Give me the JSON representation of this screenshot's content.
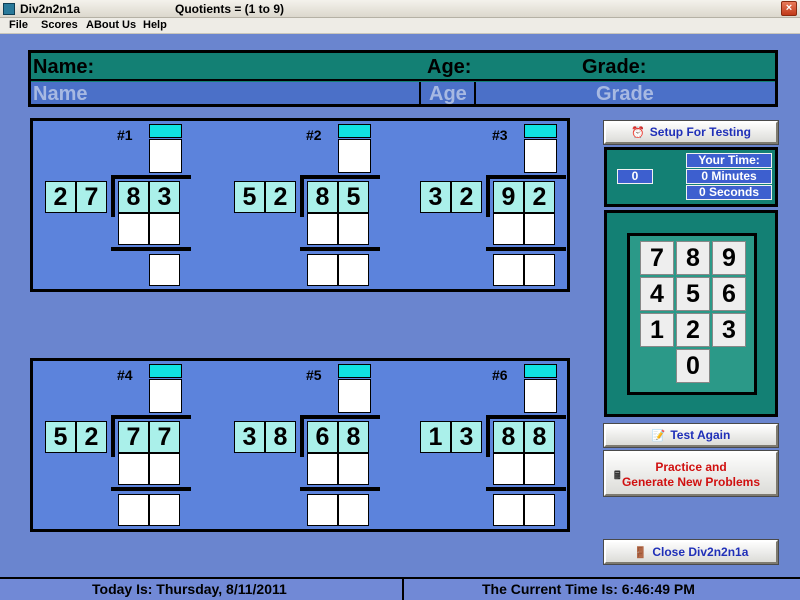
{
  "window": {
    "app_name": "Div2n2n1a",
    "title": "Quotients = (1 to 9)",
    "close_glyph": "×"
  },
  "menu": [
    {
      "label": "File"
    },
    {
      "label": "Scores"
    },
    {
      "label": "ABout Us"
    },
    {
      "label": "Help"
    }
  ],
  "student_info": {
    "name_label": "Name:",
    "age_label": "Age:",
    "grade_label": "Grade:",
    "name_placeholder": "Name",
    "age_placeholder": "Age",
    "grade_placeholder": "Grade"
  },
  "problems": [
    {
      "label": "#1",
      "divisor": [
        "2",
        "7"
      ],
      "dividend": [
        "8",
        "3"
      ]
    },
    {
      "label": "#2",
      "divisor": [
        "5",
        "2"
      ],
      "dividend": [
        "8",
        "5"
      ]
    },
    {
      "label": "#3",
      "divisor": [
        "3",
        "2"
      ],
      "dividend": [
        "9",
        "2"
      ]
    },
    {
      "label": "#4",
      "divisor": [
        "5",
        "2"
      ],
      "dividend": [
        "7",
        "7"
      ]
    },
    {
      "label": "#5",
      "divisor": [
        "3",
        "8"
      ],
      "dividend": [
        "6",
        "8"
      ]
    },
    {
      "label": "#6",
      "divisor": [
        "1",
        "3"
      ],
      "dividend": [
        "8",
        "8"
      ]
    }
  ],
  "controls": {
    "setup_label": "Setup  For Testing",
    "setup_icon": "alarm-clock-icon",
    "test_again_label": "Test Again",
    "test_again_icon": "notepad-icon",
    "practice_label_1": "Practice and",
    "practice_label_2": "Generate New Problems",
    "practice_icon": "calculator-icon",
    "close_label": "Close Div2n2n1a",
    "close_icon": "door-exit-icon"
  },
  "timer": {
    "count": "0",
    "your_time_label": "Your Time:",
    "minutes": "0 Minutes",
    "seconds": "0 Seconds"
  },
  "keypad": {
    "rows": [
      [
        "7",
        "8",
        "9"
      ],
      [
        "4",
        "5",
        "6"
      ],
      [
        "1",
        "2",
        "3"
      ],
      [
        "0"
      ]
    ]
  },
  "status": {
    "date_text": "Today Is:  Thursday, 8/11/2011",
    "time_text": "The Current Time Is:    6:46:49 PM"
  },
  "colors": {
    "background": "#6a85cf",
    "panel_teal": "#138074",
    "answer_cyan": "#10e2e2",
    "digit_cell": "#aaf0ea",
    "practice_text": "#d01010",
    "link_blue": "#1f2fb8"
  }
}
